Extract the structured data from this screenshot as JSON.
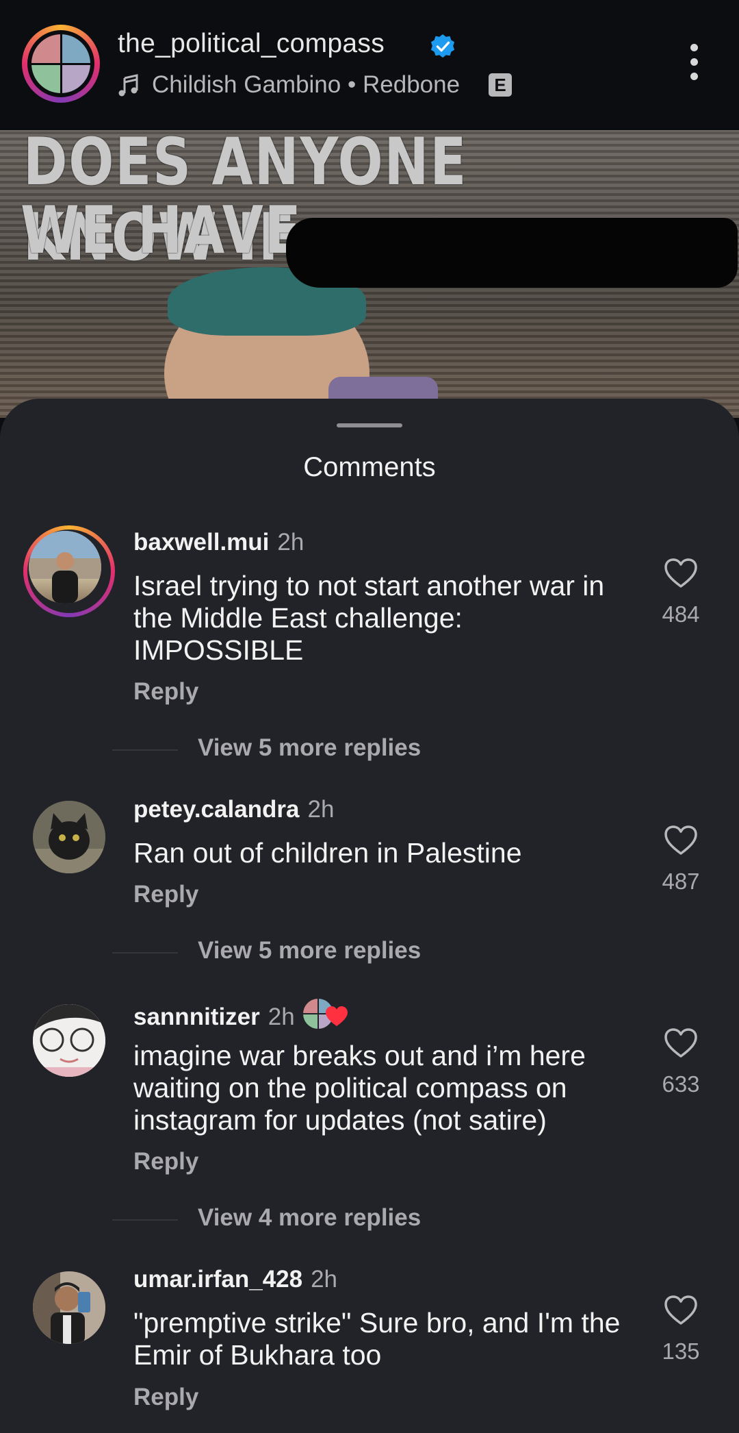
{
  "header": {
    "account_name": "the_political_compass",
    "song_artist": "Childish Gambino",
    "separator": "•",
    "song_title": "Redbone",
    "explicit_label": "E"
  },
  "video": {
    "meme_line_1": "DOES ANYONE KNOW IF",
    "meme_line_2": "WE HAVE"
  },
  "sheet": {
    "title": "Comments"
  },
  "comments": [
    {
      "username": "baxwell.mui",
      "time": "2h",
      "text": "Israel trying to not start another war in the Middle East challenge: IMPOSSIBLE",
      "reply_label": "Reply",
      "likes": "484",
      "view_replies": "View 5 more replies"
    },
    {
      "username": "petey.calandra",
      "time": "2h",
      "text": "Ran out of children in Palestine",
      "reply_label": "Reply",
      "likes": "487",
      "view_replies": "View 5 more replies"
    },
    {
      "username": "sannnitizer",
      "time": "2h",
      "text": "imagine war breaks out and i’m here waiting on the political compass on instagram for updates (not satire)",
      "reply_label": "Reply",
      "likes": "633",
      "view_replies": "View 4 more replies"
    },
    {
      "username": "umar.irfan_428",
      "time": "2h",
      "text": "\"premptive strike\" Sure bro, and I'm the Emir of Bukhara too",
      "reply_label": "Reply",
      "likes": "135"
    }
  ],
  "icons": {
    "verified": "verified-badge-icon",
    "music": "music-note-icon",
    "more": "more-vertical-icon",
    "like": "heart-outline-icon"
  },
  "colors": {
    "sheet_bg": "#222328",
    "verified_blue": "#1d9bf0",
    "story_ring": "#e1306c",
    "heart_red": "#ff3040"
  }
}
